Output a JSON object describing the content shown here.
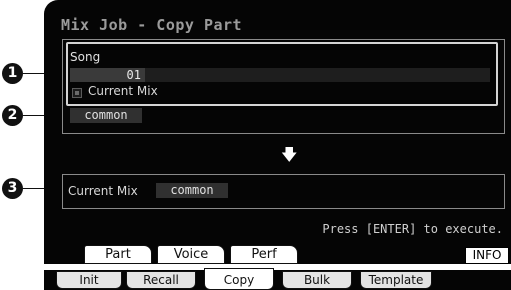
{
  "screen": {
    "title": "Mix Job - Copy Part"
  },
  "source": {
    "song_label": "Song",
    "song_number": "01",
    "current_mix_label": "Current Mix",
    "part": "common"
  },
  "destination": {
    "label": "Current Mix",
    "part": "common"
  },
  "arrow": "🡇",
  "hint": "Press [ENTER] to execute.",
  "tabs_top": [
    "Part",
    "Voice",
    "Perf"
  ],
  "info_button": "INFO",
  "tabs_bottom": [
    "Init",
    "Recall",
    "Copy",
    "Bulk",
    "Template"
  ],
  "active_bottom_tab": "Copy",
  "callouts": [
    "1",
    "2",
    "3"
  ]
}
